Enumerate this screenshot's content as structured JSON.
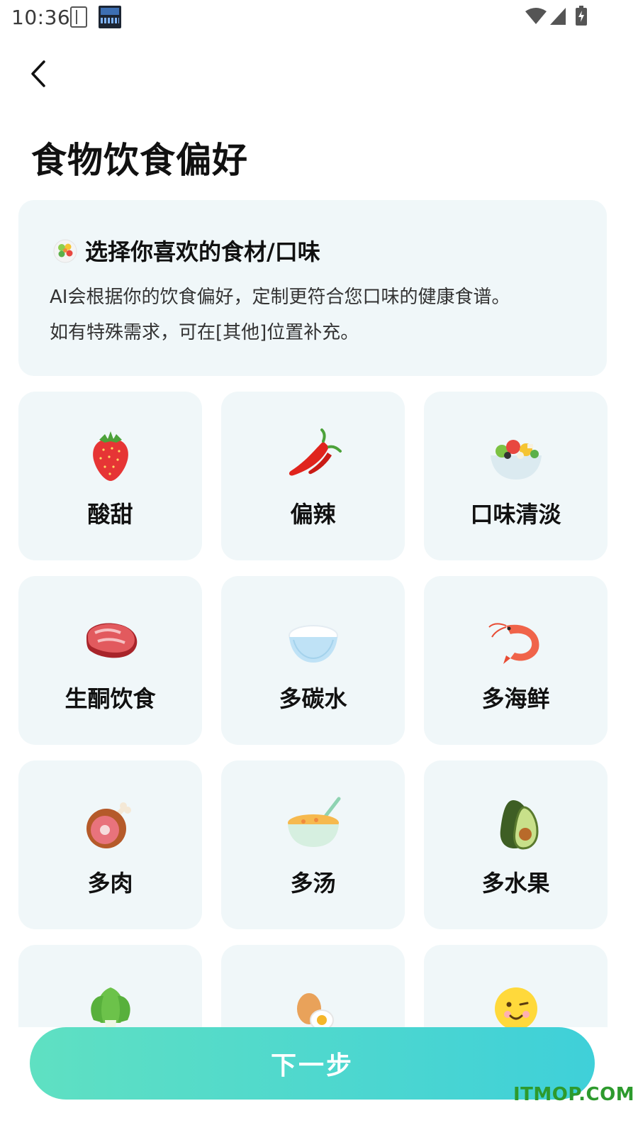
{
  "status_bar": {
    "time": "10:36",
    "icons": [
      "notebook-icon",
      "clock-widget-icon",
      "wifi-icon",
      "signal-icon",
      "battery-charging-icon"
    ]
  },
  "header": {
    "back_icon": "chevron-left-icon",
    "title": "食物饮食偏好"
  },
  "info": {
    "icon": "salad-icon",
    "heading": "选择你喜欢的食材/口味",
    "line1": "AI会根据你的饮食偏好，定制更符合您口味的健康食谱。",
    "line2": "如有特殊需求，可在[其他]位置补充。"
  },
  "options": [
    {
      "label": "酸甜",
      "icon": "strawberry-icon"
    },
    {
      "label": "偏辣",
      "icon": "chili-pepper-icon"
    },
    {
      "label": "口味清淡",
      "icon": "salad-bowl-icon"
    },
    {
      "label": "生酮饮食",
      "icon": "steak-icon"
    },
    {
      "label": "多碳水",
      "icon": "rice-bowl-icon"
    },
    {
      "label": "多海鲜",
      "icon": "shrimp-icon"
    },
    {
      "label": "多肉",
      "icon": "ham-leg-icon"
    },
    {
      "label": "多汤",
      "icon": "soup-bowl-icon"
    },
    {
      "label": "多水果",
      "icon": "avocado-icon"
    },
    {
      "label": "",
      "icon": "bok-choy-icon"
    },
    {
      "label": "",
      "icon": "eggs-icon"
    },
    {
      "label": "",
      "icon": "smiley-face-icon"
    }
  ],
  "footer": {
    "next_label": "下一步"
  },
  "watermark": "ITMOP.COM",
  "colors": {
    "card_bg": "#f0f7f9",
    "button_gradient_start": "#5fe0c2",
    "button_gradient_end": "#3fd0d9",
    "watermark": "#2d9a2d"
  }
}
